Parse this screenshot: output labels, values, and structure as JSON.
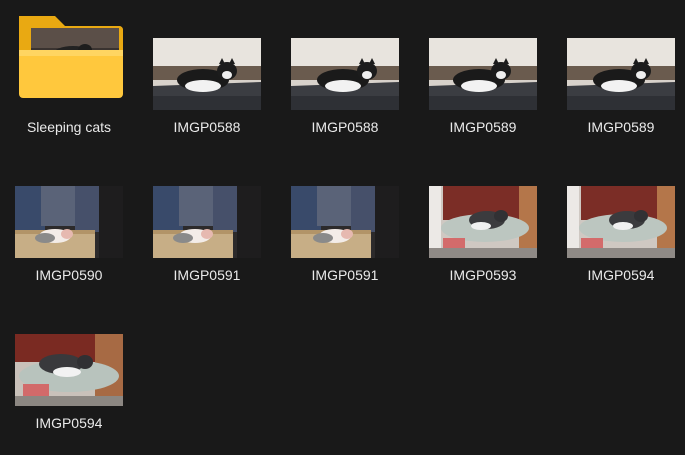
{
  "view": {
    "background": "#191919",
    "items": [
      {
        "name": "Sleeping cats",
        "type": "folder",
        "icon": "folder-icon"
      },
      {
        "name": "IMGP0588",
        "type": "image",
        "scene": "cat-blanket"
      },
      {
        "name": "IMGP0588",
        "type": "image",
        "scene": "cat-blanket"
      },
      {
        "name": "IMGP0589",
        "type": "image",
        "scene": "cat-blanket"
      },
      {
        "name": "IMGP0589",
        "type": "image",
        "scene": "cat-blanket"
      },
      {
        "name": "IMGP0590",
        "type": "image",
        "scene": "cat-basket"
      },
      {
        "name": "IMGP0591",
        "type": "image",
        "scene": "cat-basket"
      },
      {
        "name": "IMGP0591",
        "type": "image",
        "scene": "cat-basket"
      },
      {
        "name": "IMGP0593",
        "type": "image",
        "scene": "cat-chair"
      },
      {
        "name": "IMGP0594",
        "type": "image",
        "scene": "cat-chair"
      },
      {
        "name": "IMGP0594",
        "type": "image",
        "scene": "cat-chair"
      }
    ]
  }
}
